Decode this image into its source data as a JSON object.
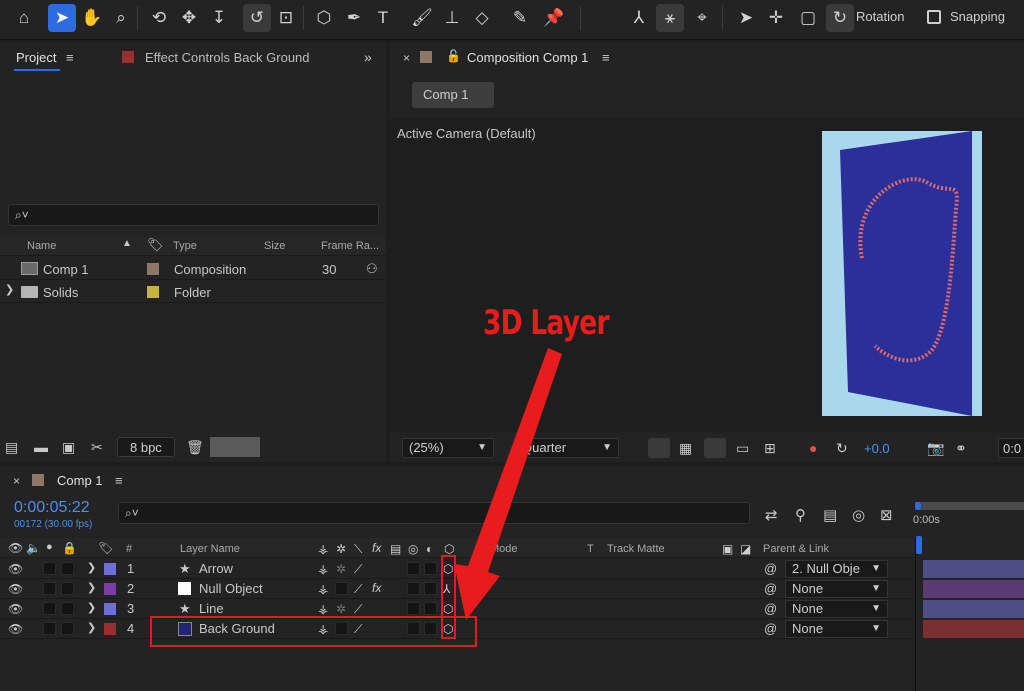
{
  "toolbar": {
    "tools": [
      "home-icon",
      "selection-icon",
      "hand-icon",
      "zoom-icon",
      "orbit-icon",
      "pan-icon",
      "dolly-icon",
      "rotate-icon",
      "pan-behind-icon",
      "shape-icon",
      "pen-icon",
      "type-icon",
      "brush-icon",
      "clone-stamp-icon",
      "eraser-icon",
      "roto-brush-icon",
      "puppet-icon"
    ],
    "rotation_label": "Rotation",
    "snapping_label": "Snapping"
  },
  "project": {
    "tab_project": "Project",
    "tab_effects": "Effect Controls Back Ground",
    "search_placeholder": "",
    "columns": {
      "name": "Name",
      "type": "Type",
      "size": "Size",
      "frame_rate": "Frame Ra..."
    },
    "items": [
      {
        "name": "Comp 1",
        "type": "Composition",
        "frame_rate": "30",
        "label_color": "#8d7766"
      },
      {
        "name": "Solids",
        "type": "Folder",
        "frame_rate": "",
        "label_color": "#c8b33a"
      }
    ],
    "bpc": "8 bpc"
  },
  "composition": {
    "tab_title": "Composition Comp 1",
    "comp_button": "Comp 1",
    "camera_label": "Active Camera (Default)",
    "zoom": "(25%)",
    "resolution": "Quarter",
    "exposure": "+0.0",
    "timecode_fragment": "0:0"
  },
  "annotation": {
    "label": "3D Layer"
  },
  "timeline": {
    "tab_title": "Comp 1",
    "timecode": "0:00:05:22",
    "frames": "00172 (30.00 fps)",
    "ruler_start": "0:00s",
    "columns": {
      "layer_name": "Layer Name",
      "number": "#",
      "mode": "Mode",
      "t": "T",
      "track_matte": "Track Matte",
      "parent": "Parent & Link"
    },
    "layers": [
      {
        "num": "1",
        "name": "Arrow",
        "color": "#6f6fd6",
        "parent": "2. Null Obje",
        "bar_color": "#4b4f86"
      },
      {
        "num": "2",
        "name": "Null Object",
        "color": "#7a3ea6",
        "parent": "None",
        "bar_color": "#5a3a72"
      },
      {
        "num": "3",
        "name": "Line",
        "color": "#6f6fd6",
        "parent": "None",
        "bar_color": "#4b4f86"
      },
      {
        "num": "4",
        "name": "Back Ground",
        "color": "#9b2e2e",
        "parent": "None",
        "bar_color": "#7a3030"
      }
    ]
  }
}
